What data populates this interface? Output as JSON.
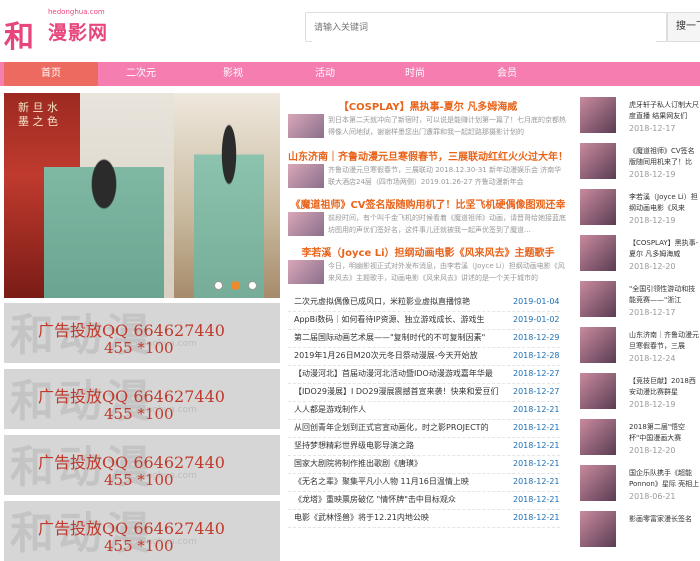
{
  "header": {
    "logo_char": "和",
    "logo_domain": "hedonghua.com",
    "logo_name": "漫影网",
    "search_placeholder": "请输入关键词",
    "search_button": "搜一下"
  },
  "nav": [
    "首页",
    "二次元",
    "影视",
    "活动",
    "时尚",
    "会员"
  ],
  "banner": {
    "calligraphy": "新 旦 水 墨 之 色",
    "dots": 3,
    "active_dot": 1
  },
  "ads": [
    {
      "line1": "广告投放QQ 664627440",
      "line2": "455 *100",
      "watermark": "和动漫",
      "wm_url": "hedonghua.com"
    },
    {
      "line1": "广告投放QQ 664627440",
      "line2": "455 *100",
      "watermark": "和动漫",
      "wm_url": "hedonghua.com"
    },
    {
      "line1": "广告投放QQ 664627440",
      "line2": "455 *100",
      "watermark": "和动漫",
      "wm_url": "hedonghua.com"
    },
    {
      "line1": "广告投放QQ 664627440",
      "line2": "455 *100",
      "watermark": "和动漫",
      "wm_url": "hedonghua.com"
    }
  ],
  "featured": [
    {
      "title": "【COSPLAY】黑执事-夏尔 凡多姆海威",
      "desc": "到日本第二天就冲向了新宿时，可以说是能赚计划第一篇了！七月底的京都热得像人间地狱，谢谢样墨您出门遭罪和我一起赶路那摄影计划的"
    },
    {
      "title": "山东济南｜齐鲁动漫元旦寒假春节，三展联动红红火火过大年！",
      "desc": "齐鲁动漫元旦寒假春节，三展联动 2018.12.30-31 新年动漫娱乐会 济南华联大酒店24层（四市场两侧）2019.01.26-27 齐鲁动漫新年会"
    },
    {
      "title": "《魔道祖师》CV签名版随购用机了！比坚飞机硬偶像图观还幸",
      "desc": "前段时间，有个叫千金飞机的时候看着《魔道祖师》动画，请晋哥给她接蓝底坊图用的声优们签好名，这件事儿还就被我一起声优签到了魔道..."
    },
    {
      "title": "李若溪（Joyce Li）担纲动画电影《风来风去》主题歌手",
      "desc": "今日，明幽影视正式对外发布消息，由李若溪（Joyce Li）担纲动画电影《风来风去》主题歌手，动画电影《风来风去》讲述的是一个关于城市的"
    }
  ],
  "news": [
    {
      "text": "二次元虚拟偶像已成风口，米粒影业虚拟直播惊艳",
      "date": "2019-01-04"
    },
    {
      "text": "AppBi数码｜如何看待IP资源、独立游戏成长、游戏生",
      "date": "2019-01-02"
    },
    {
      "text": "第二届国际动画艺术展——\"复制时代的不可复制因素\"",
      "date": "2018-12-29"
    },
    {
      "text": "2019年1月26日M20次元冬日祭动漫展-今天开始放",
      "date": "2018-12-28"
    },
    {
      "text": "【动漫河北】首届动漫河北活动暨IDO动漫游戏嘉年华最",
      "date": "2018-12-27"
    },
    {
      "text": "【IDO29漫展】I DO29漫展震撼首宣来袭！快来和爱豆们",
      "date": "2018-12-27"
    },
    {
      "text": "人人都是游戏制作人",
      "date": "2018-12-21"
    },
    {
      "text": "从回创青年企划到正式官宣动画化，时之影PROJECT的",
      "date": "2018-12-21"
    },
    {
      "text": "坚持梦想精彩世界级电影导演之路",
      "date": "2018-12-21"
    },
    {
      "text": "国家大剧院将制作推出歌剧《唐璜》",
      "date": "2018-12-21"
    },
    {
      "text": "《无名之辈》聚集平凡小人物 11月16日温情上映",
      "date": "2018-12-21"
    },
    {
      "text": "《龙塔》重映票房破亿 \"情怀牌\"击中目标观众",
      "date": "2018-12-21"
    },
    {
      "text": "电影《武林怪兽》将于12.21内地公映",
      "date": "2018-12-21"
    }
  ],
  "side": [
    {
      "title": "虎牙轩子私人订制大尺度直播 结果网友们",
      "date": "2018-12-17"
    },
    {
      "title": "《魔道祖师》CV签名版随同用机来了！比",
      "date": "2018-12-19"
    },
    {
      "title": "李若溪（Joyce Li）担纲动画电影《风来",
      "date": "2018-12-19"
    },
    {
      "title": "【COSPLAY】黑执事-夏尔 凡多姆海威",
      "date": "2018-12-20"
    },
    {
      "title": "\"全国引领性游动和技能竞赛——\"浙江",
      "date": "2018-12-17"
    },
    {
      "title": "山东济南｜齐鲁动漫元旦寒假春节，三展",
      "date": "2018-12-24"
    },
    {
      "title": "【竞技巨献】2018西安动漫比赛群星",
      "date": "2018-12-19"
    },
    {
      "title": "2018第二届\"悟空杯\"中国漫画大赛",
      "date": "2018-12-20"
    },
    {
      "title": "国企乐队携手《超能Ponnon》星际 壳相上海",
      "date": "2018-06-21"
    },
    {
      "title": "影画零富家漫长签名",
      "date": ""
    }
  ],
  "colors": {
    "pink": "#f57db0",
    "active": "#ec6a5f",
    "orange": "#e8641b",
    "blue": "#1a6fb5"
  }
}
